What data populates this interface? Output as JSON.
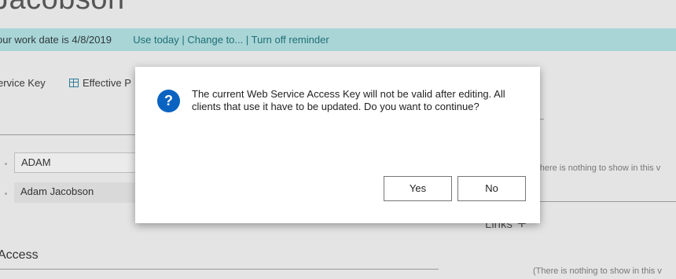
{
  "page": {
    "title": "Jacobson"
  },
  "banner": {
    "message": "our work date is 4/8/2019",
    "use_today": "Use today",
    "sep1": "|",
    "change_to": "Change to...",
    "sep2": "|",
    "turn_off": "Turn off reminder"
  },
  "actions": {
    "service_key": "ervice Key",
    "effective": "Effective P"
  },
  "fields": {
    "username": "ADAM",
    "full_name": "Adam Jacobson"
  },
  "side": {
    "nothing_top": "There is nothing to show in this v",
    "links_label": "Links",
    "links_plus": "+",
    "nothing_bottom": "(There is nothing to show in this v"
  },
  "section": {
    "access": "Access"
  },
  "dialog": {
    "icon": "?",
    "message": "The current Web Service Access Key will not be valid after editing. All clients that use it have to be updated. Do you want to continue?",
    "yes": "Yes",
    "no": "No"
  },
  "colors": {
    "banner_bg": "#a9d5d7",
    "link": "#1f6e74",
    "question_icon": "#0b63c1"
  }
}
